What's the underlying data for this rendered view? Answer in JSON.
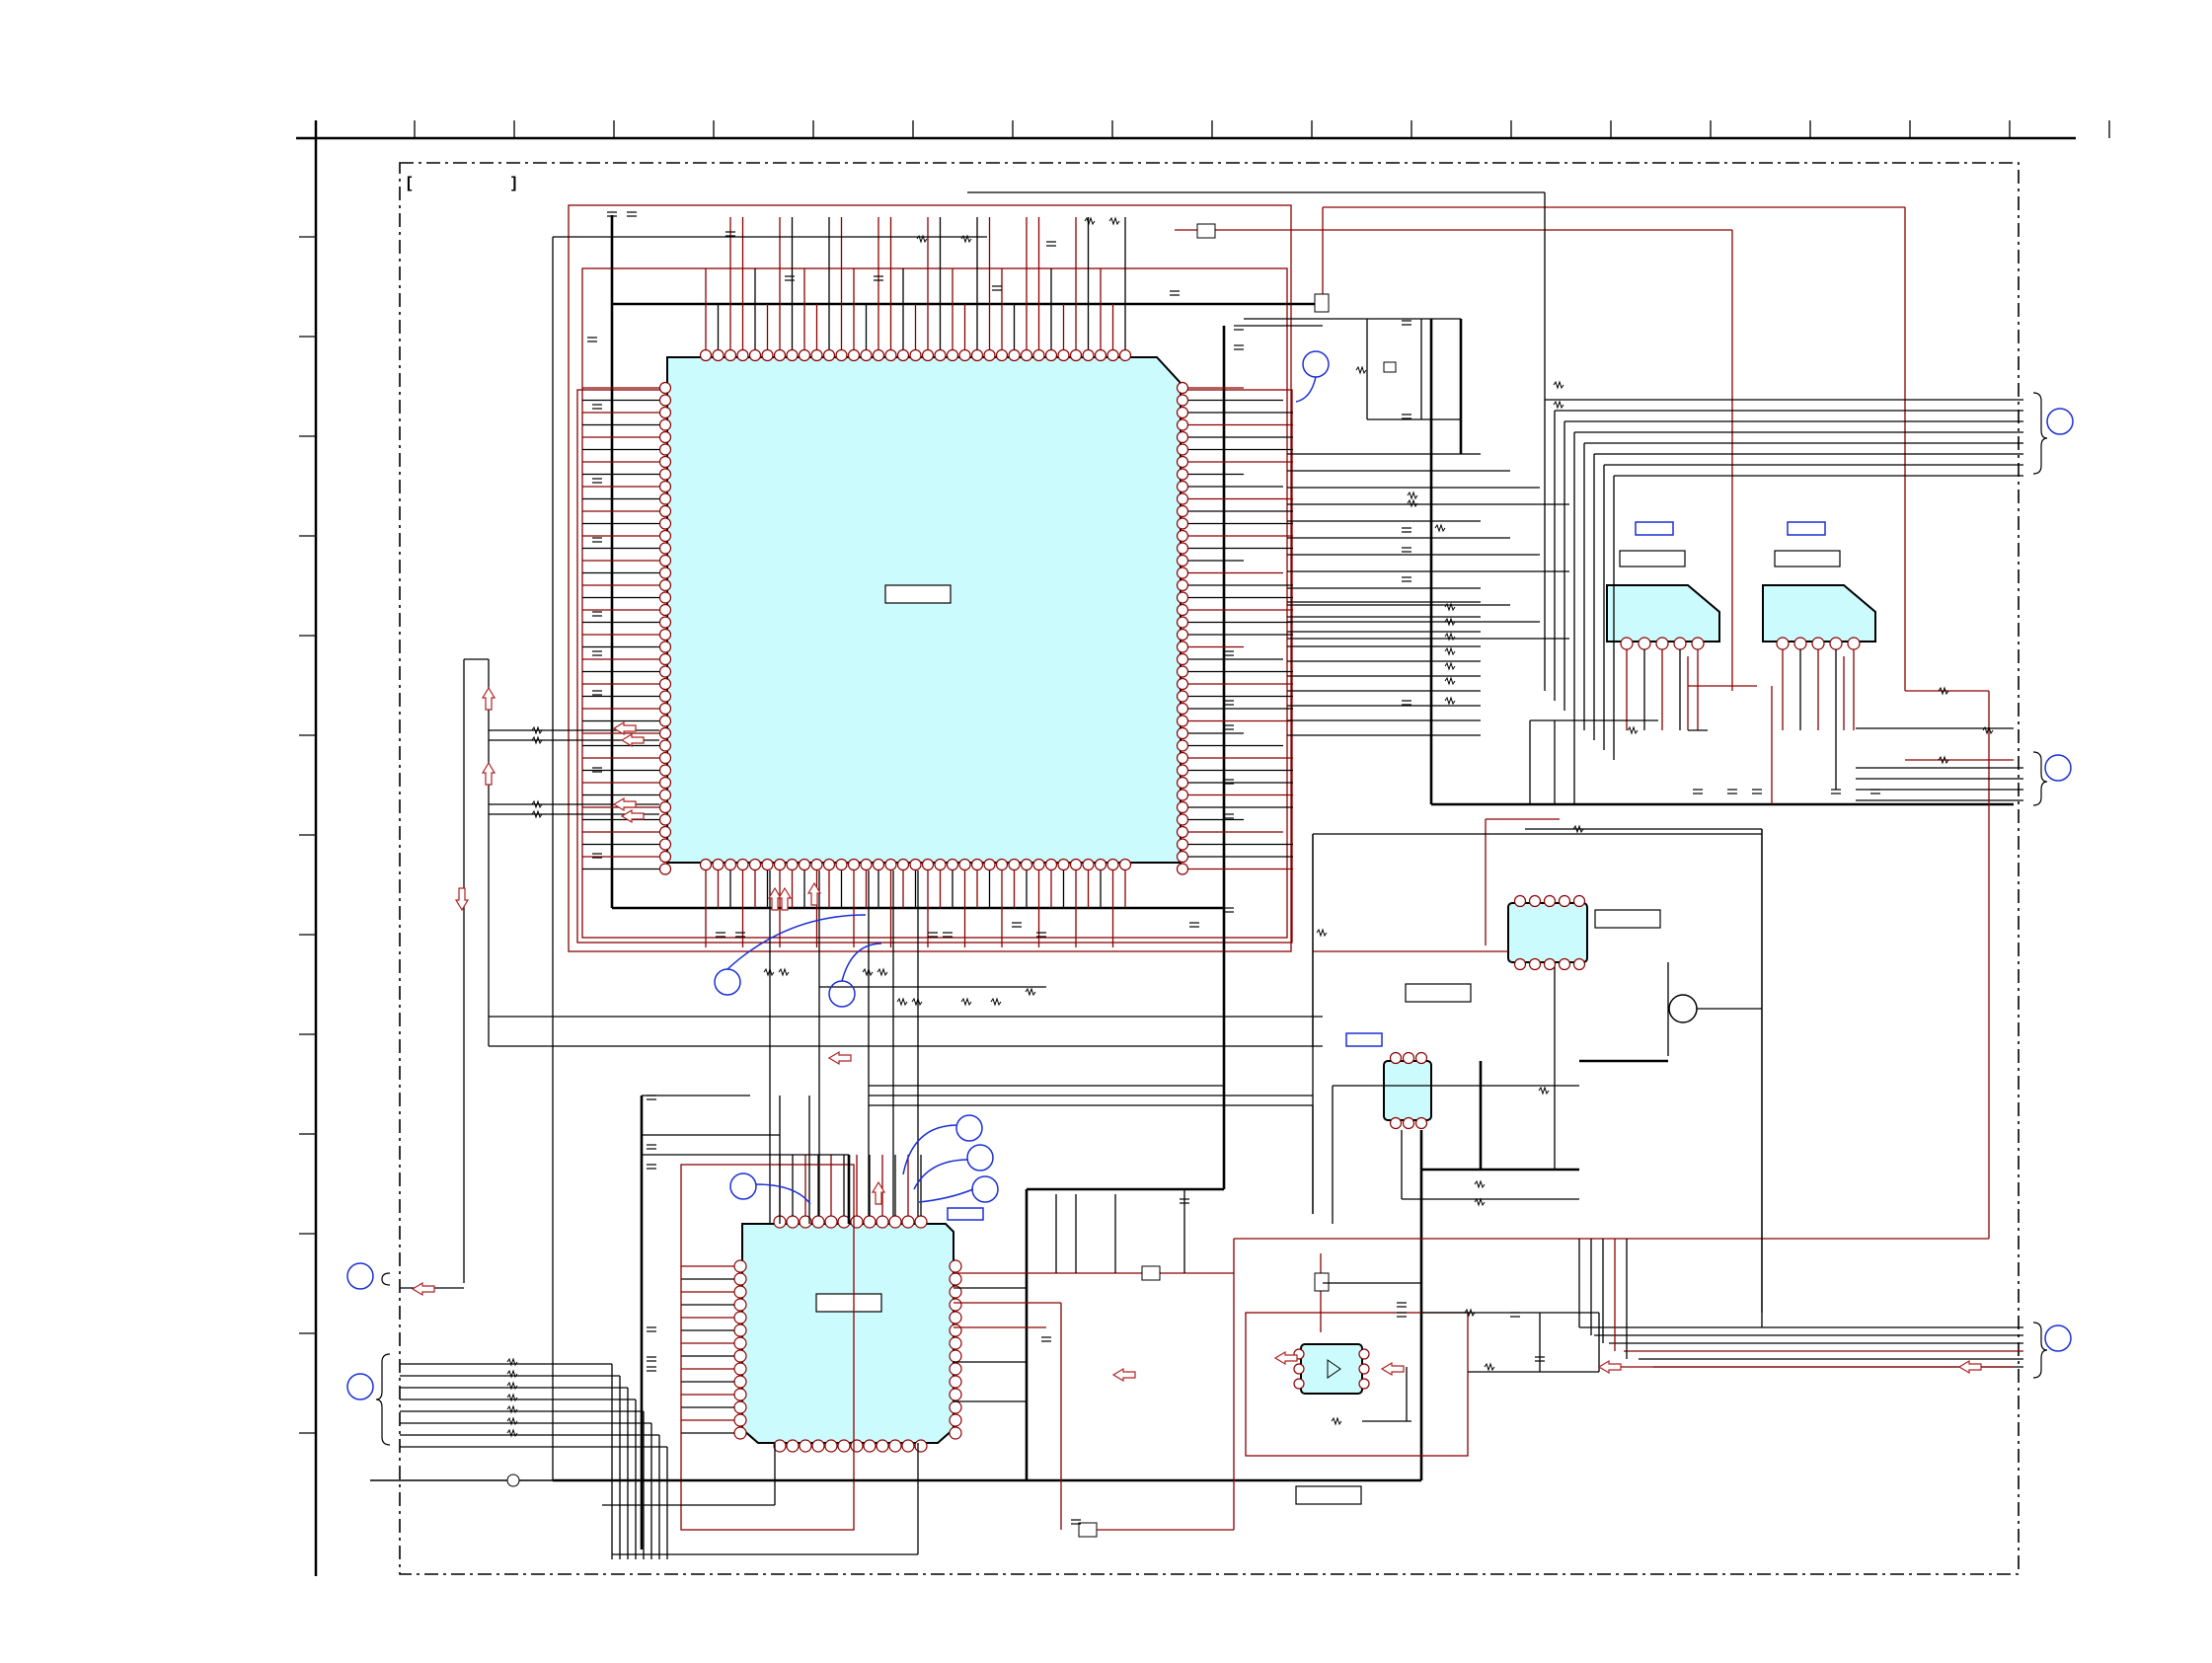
{
  "diagram": {
    "type": "circuit-schematic",
    "grid": {
      "columns": 18,
      "rows": 14
    },
    "ics": [
      {
        "id": "main-processor",
        "shape": "square-qfp"
      },
      {
        "id": "secondary-processor",
        "shape": "square-qfp"
      },
      {
        "id": "regulator-left",
        "shape": "5-pin"
      },
      {
        "id": "regulator-right",
        "shape": "5-pin"
      },
      {
        "id": "logic-gate",
        "shape": "dip-14"
      },
      {
        "id": "small-ic",
        "shape": "dip-6"
      },
      {
        "id": "opto-buffer",
        "shape": "dip-6"
      }
    ],
    "colors": {
      "wire_power": "#8b0000",
      "wire_signal": "#000000",
      "ic_fill": "#ccfbfd",
      "callout": "#1a2fd6",
      "arrow": "#b02020"
    }
  }
}
